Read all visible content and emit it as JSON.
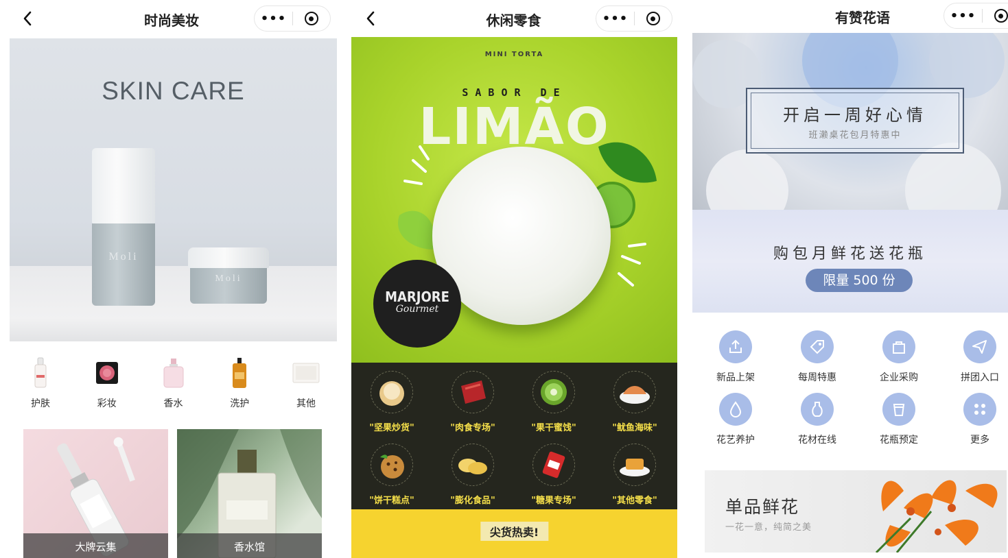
{
  "panels": {
    "beauty": {
      "title": "时尚美妆",
      "hero": {
        "headline": "SKIN CARE",
        "bottle_brand": "Moli",
        "jar_brand": "Moli"
      },
      "categories": [
        {
          "label": "护肤",
          "icon": "serum-bottle-icon"
        },
        {
          "label": "彩妆",
          "icon": "blush-compact-icon"
        },
        {
          "label": "香水",
          "icon": "perfume-bottle-icon"
        },
        {
          "label": "洗护",
          "icon": "shampoo-bottle-icon"
        },
        {
          "label": "其他",
          "icon": "gift-box-icon"
        }
      ],
      "tiles": [
        {
          "label": "大牌云集"
        },
        {
          "label": "香水馆"
        }
      ]
    },
    "snacks": {
      "title": "休闲零食",
      "hero": {
        "stamp": "MINI TORTA",
        "top_line": "SABOR DE",
        "headline": "LIMÃO",
        "badge_name": "MARJORE",
        "badge_sub": "Gourmet"
      },
      "categories": [
        {
          "label": "\"坚果炒货\"",
          "icon": "nut-icon"
        },
        {
          "label": "\"肉食专场\"",
          "icon": "meat-icon"
        },
        {
          "label": "\"果干蜜饯\"",
          "icon": "kiwi-icon"
        },
        {
          "label": "\"鱿鱼海味\"",
          "icon": "seafood-icon"
        },
        {
          "label": "\"饼干糕点\"",
          "icon": "cookie-icon"
        },
        {
          "label": "\"膨化食品\"",
          "icon": "chips-icon"
        },
        {
          "label": "\"糖果专场\"",
          "icon": "candy-icon"
        },
        {
          "label": "\"其他零食\"",
          "icon": "snack-plate-icon"
        }
      ],
      "promo": "尖货热卖!"
    },
    "flowers": {
      "title": "有赞花语",
      "hero": {
        "headline": "开启一周好心情",
        "subline": "班濑桌花包月特惠中"
      },
      "banner": {
        "headline": "购包月鲜花送花瓶",
        "pill": "限量 500 份"
      },
      "services": [
        {
          "label": "新品上架",
          "icon": "upload-icon"
        },
        {
          "label": "每周特惠",
          "icon": "tag-icon"
        },
        {
          "label": "企业采购",
          "icon": "bag-icon"
        },
        {
          "label": "拼团入口",
          "icon": "send-icon"
        },
        {
          "label": "花艺养护",
          "icon": "droplet-icon"
        },
        {
          "label": "花材在线",
          "icon": "vase-icon"
        },
        {
          "label": "花瓶预定",
          "icon": "cup-icon"
        },
        {
          "label": "更多",
          "icon": "grid-dots-icon"
        }
      ],
      "feature": {
        "title": "单品鲜花",
        "subtitle": "一花一意，纯简之美"
      }
    }
  },
  "capsule": {
    "more": "•••"
  },
  "colors": {
    "lime": "#a9d32b",
    "snack_label": "#f6e04a",
    "flower_accent": "#6d86b9",
    "dark_strip": "#25261e",
    "promo_yellow": "#f6d32f"
  }
}
